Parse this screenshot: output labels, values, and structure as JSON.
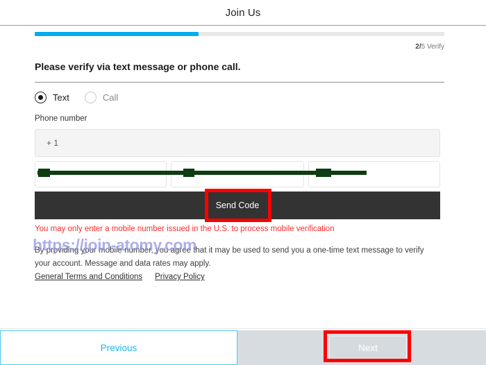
{
  "header": {
    "title": "Join Us"
  },
  "progress": {
    "percent": 40,
    "step_current": "2",
    "step_total": "5",
    "step_separator": "/",
    "step_label": "Verify",
    "fill_color": "#00aeef",
    "track_color": "#e9e9e9"
  },
  "form": {
    "prompt": "Please verify via text message or phone call.",
    "methods": [
      {
        "label": "Text",
        "selected": true
      },
      {
        "label": "Call",
        "selected": false
      }
    ],
    "phone_label": "Phone number",
    "country_code_value": "+ 1",
    "number_parts": [
      {
        "value": "",
        "placeholder": ""
      },
      {
        "value": "",
        "placeholder": ""
      },
      {
        "value": "",
        "placeholder": ""
      }
    ],
    "send_code_label": "Send Code",
    "error_message": "You may only enter a mobile number issued in the U.S. to process mobile verification",
    "consent_text": "By providing your mobile number, you agree that it may be used to send you a one-time text message to verify your account. Message and data rates may apply.",
    "links": [
      {
        "label": "General Terms and Conditions"
      },
      {
        "label": "Privacy Policy"
      }
    ]
  },
  "watermark": {
    "text": "https://join-atomy.com",
    "color": "#8f8fe0"
  },
  "footer": {
    "previous_label": "Previous",
    "next_label": "Next",
    "previous_color": "#1fb6e8",
    "next_disabled": true
  },
  "annotations": {
    "color": "#fe0000",
    "targets": [
      "send-code-button",
      "next-button"
    ]
  }
}
